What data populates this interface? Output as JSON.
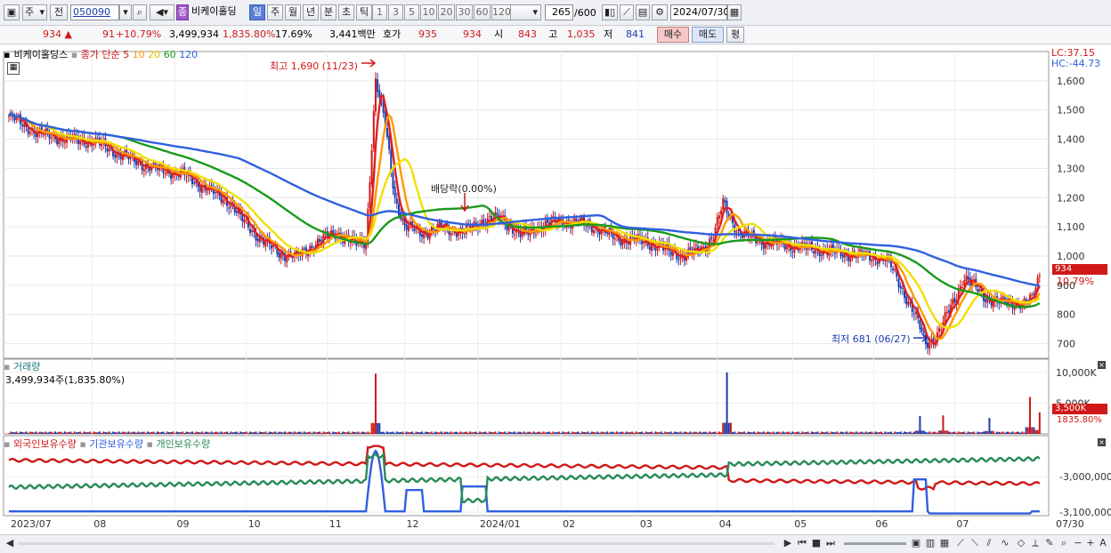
{
  "toolbar": {
    "combo1": "주",
    "combo2": "전",
    "code": "050090",
    "stock_name": "비케이홀딩",
    "stock_prefix": "종",
    "periods": [
      "일",
      "주",
      "월",
      "년",
      "분",
      "초",
      "틱"
    ],
    "intervals": [
      "1",
      "3",
      "5",
      "10",
      "20",
      "30",
      "60",
      "120"
    ],
    "count": "265",
    "count_max": "/600",
    "date": "2024/07/30"
  },
  "info": {
    "price": "934",
    "change": "91",
    "change_pct": "+10.79%",
    "volume": "3,499,934",
    "volume_pct": "1,835.80%",
    "turnover": "17.69%",
    "amount": "3,441",
    "amount_unit": "백만",
    "hoga_label": "호가",
    "ask": "935",
    "bid": "934",
    "open_label": "시",
    "open": "843",
    "high_label": "고",
    "high": "1,035",
    "low_label": "저",
    "low": "841",
    "buy_btn": "매수",
    "sell_btn": "매도",
    "eval_btn": "평"
  },
  "main_panel": {
    "stock_label": "비케이홀딩스",
    "ma_label": "종가 단순",
    "ma_periods": [
      "5",
      "10",
      "20",
      "60",
      "120"
    ],
    "ma_colors": [
      "#e02020",
      "#ff9a00",
      "#f0e000",
      "#1a9a1a",
      "#3060e0"
    ],
    "lc": "LC:37.15",
    "hc": "HC:-44.73",
    "high_annot": "최고 1,690 (11/23)",
    "low_annot": "최저 681 (06/27)",
    "dividend_annot": "배당락(0.00%)",
    "price_axis": [
      "1,600",
      "1,500",
      "1,400",
      "1,300",
      "1,200",
      "1,100",
      "1,000",
      "900",
      "800",
      "700"
    ],
    "last_price_tag": "934",
    "last_pct_tag": "10.79%"
  },
  "volume_panel": {
    "title": "거래량",
    "value": "3,499,934주(1,835.80%)",
    "axis": [
      "10,000K",
      "5,000K"
    ],
    "tag": "3,500K",
    "tag_pct": "1835.80%"
  },
  "holding_panel": {
    "series": [
      "외국인보유수량",
      "기관보유수량",
      "개인보유수량"
    ],
    "series_colors": [
      "#d01818",
      "#3060e0",
      "#2a8a5a"
    ],
    "axis": [
      "-3,000,000",
      "-3,100,000"
    ]
  },
  "x_axis": [
    "2023/07",
    "08",
    "09",
    "10",
    "11",
    "12",
    "2024/01",
    "02",
    "03",
    "04",
    "05",
    "06",
    "07",
    "07/30"
  ],
  "chart_data": {
    "type": "candlestick",
    "title": "비케이홀딩스",
    "ylim": [
      650,
      1700
    ],
    "price_ticks": [
      1600,
      1500,
      1400,
      1300,
      1200,
      1100,
      1000,
      900,
      800,
      700
    ],
    "close_path": [
      [
        0,
        1480
      ],
      [
        15,
        1420
      ],
      [
        30,
        1400
      ],
      [
        45,
        1390
      ],
      [
        60,
        1340
      ],
      [
        75,
        1300
      ],
      [
        90,
        1280
      ],
      [
        100,
        1240
      ],
      [
        115,
        1180
      ],
      [
        120,
        1130
      ],
      [
        130,
        1060
      ],
      [
        140,
        1010
      ],
      [
        150,
        1000
      ],
      [
        160,
        1050
      ],
      [
        170,
        1080
      ],
      [
        180,
        1040
      ],
      [
        185,
        1050
      ],
      [
        190,
        1600
      ],
      [
        195,
        1450
      ],
      [
        200,
        1200
      ],
      [
        205,
        1100
      ],
      [
        215,
        1080
      ],
      [
        225,
        1100
      ],
      [
        235,
        1080
      ],
      [
        245,
        1120
      ],
      [
        255,
        1130
      ],
      [
        265,
        1070
      ],
      [
        275,
        1100
      ],
      [
        285,
        1120
      ],
      [
        300,
        1110
      ],
      [
        315,
        1060
      ],
      [
        330,
        1050
      ],
      [
        340,
        1020
      ],
      [
        350,
        1000
      ],
      [
        360,
        1030
      ],
      [
        365,
        1070
      ],
      [
        370,
        1180
      ],
      [
        378,
        1080
      ],
      [
        390,
        1050
      ],
      [
        400,
        1040
      ],
      [
        410,
        1030
      ],
      [
        420,
        1020
      ],
      [
        430,
        1010
      ],
      [
        445,
        1000
      ],
      [
        455,
        990
      ],
      [
        470,
        790
      ],
      [
        475,
        700
      ],
      [
        480,
        720
      ],
      [
        490,
        850
      ],
      [
        495,
        930
      ],
      [
        505,
        860
      ],
      [
        515,
        840
      ],
      [
        525,
        840
      ],
      [
        530,
        850
      ],
      [
        534,
        934
      ]
    ],
    "volume_spikes": [
      [
        190,
        9800
      ],
      [
        372,
        10000
      ],
      [
        472,
        2900
      ],
      [
        484,
        3000
      ],
      [
        508,
        2600
      ],
      [
        529,
        6000
      ],
      [
        534,
        3500
      ]
    ],
    "series": [
      {
        "name": "외국인보유수량",
        "color": "#d01818"
      },
      {
        "name": "기관보유수량",
        "color": "#3060e0"
      },
      {
        "name": "개인보유수량",
        "color": "#2a8a5a"
      }
    ]
  }
}
